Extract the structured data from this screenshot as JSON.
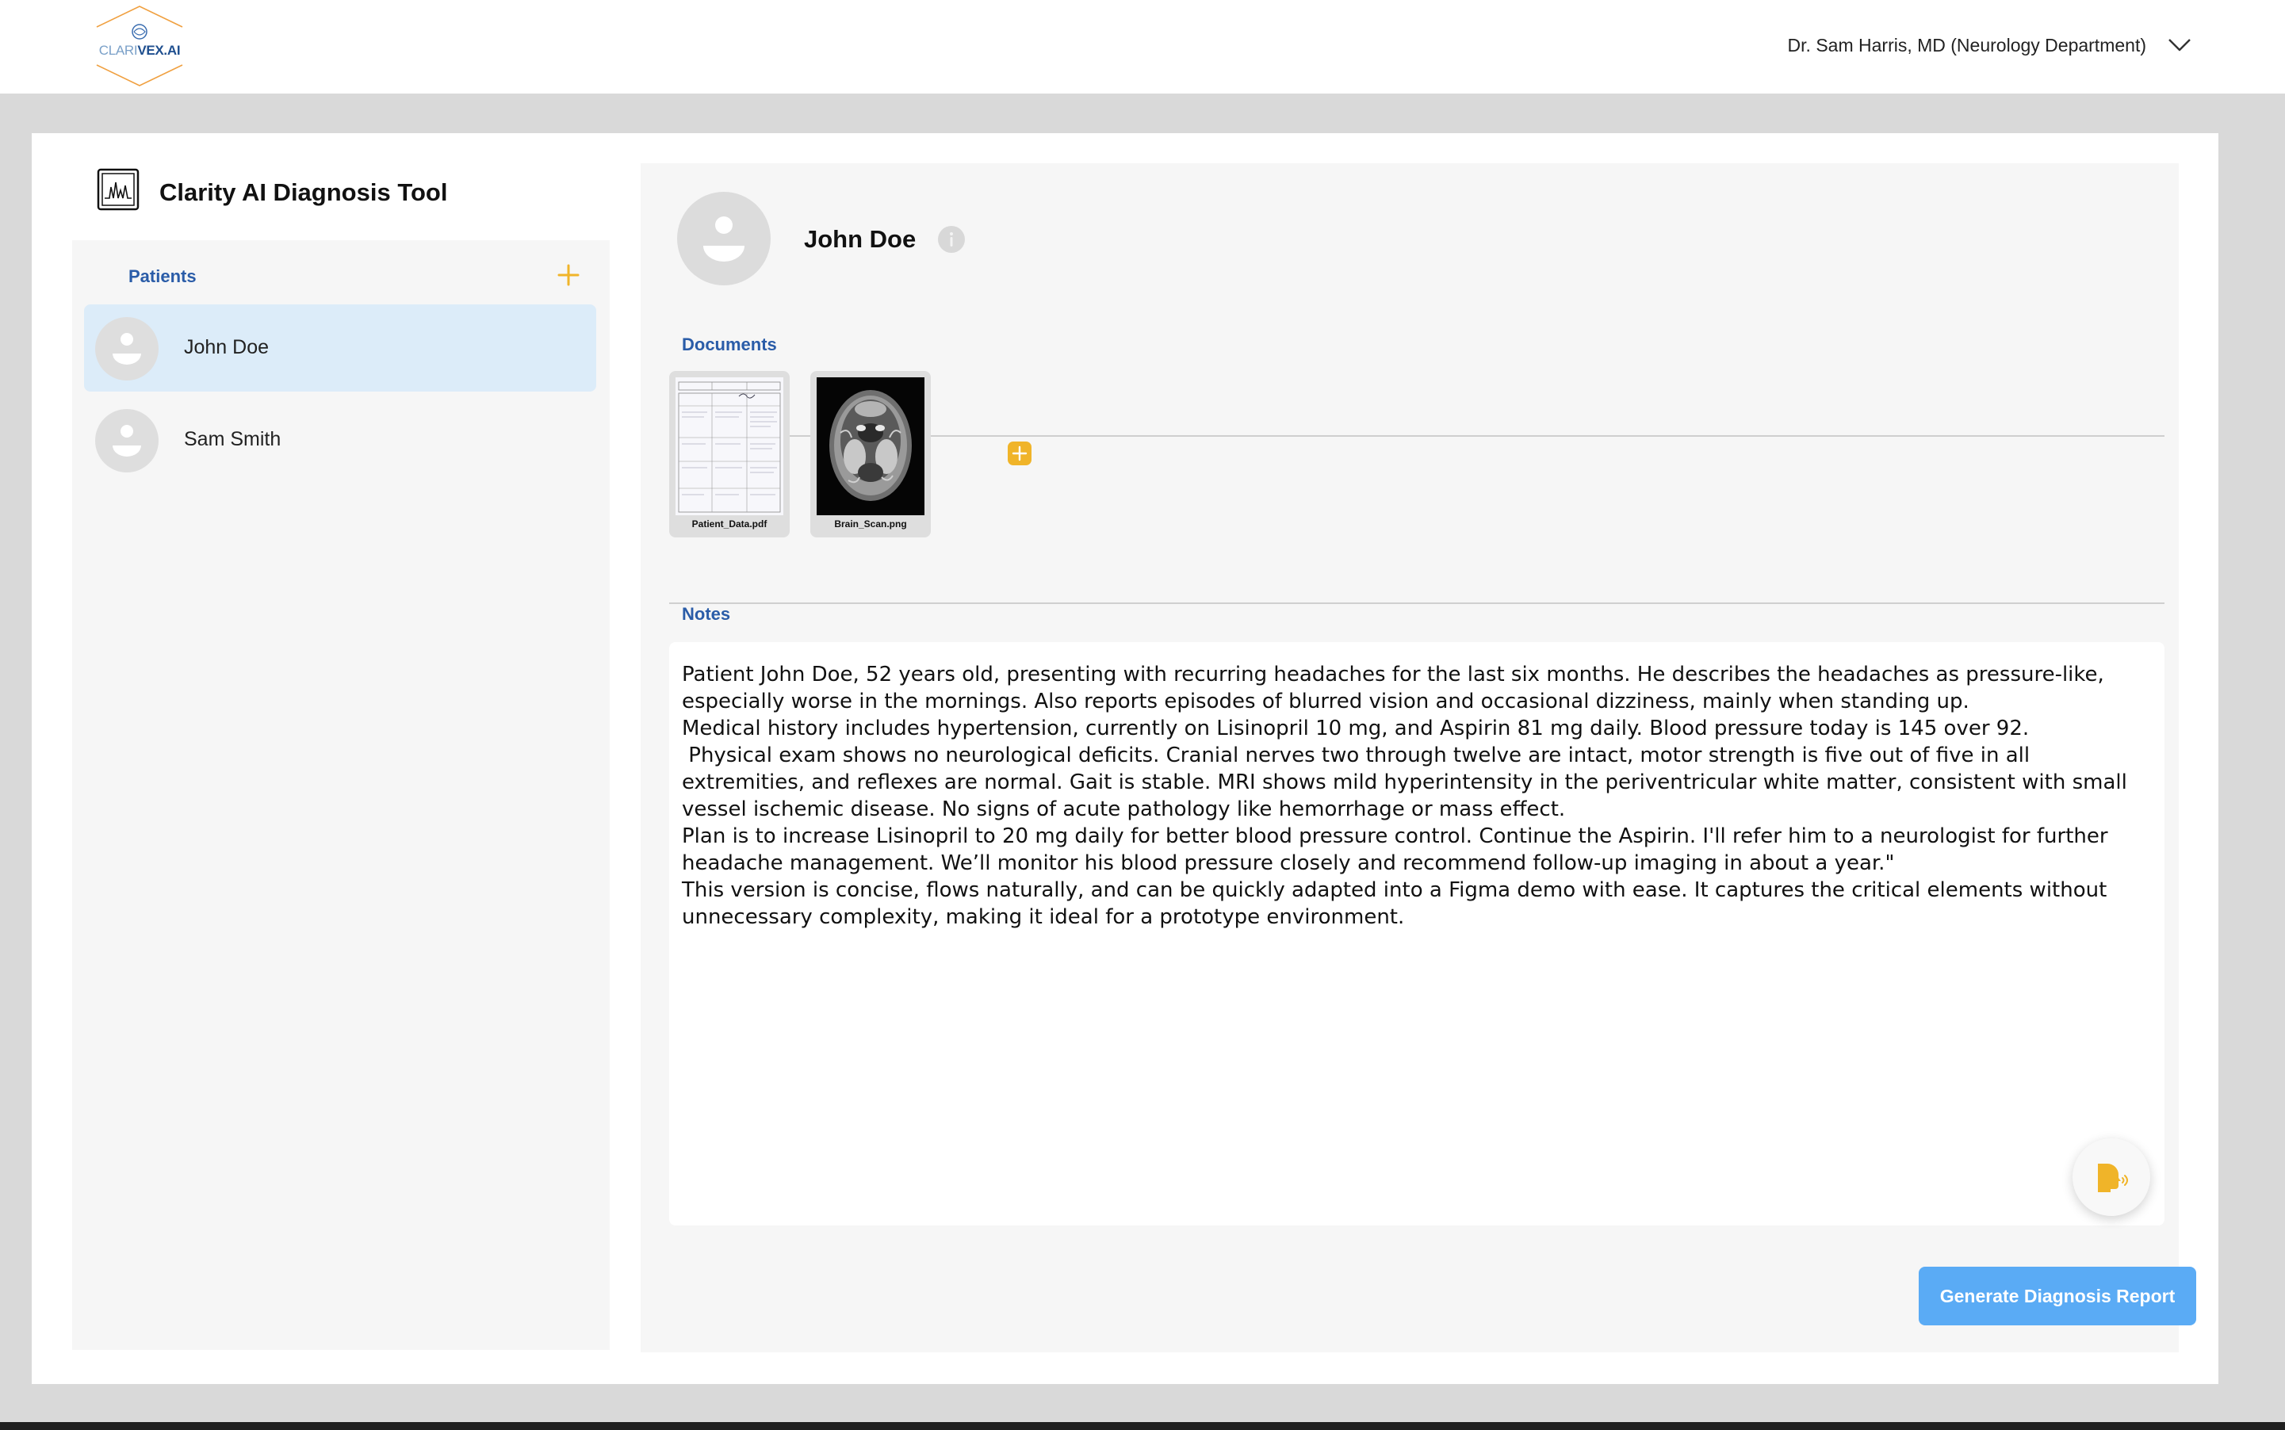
{
  "header": {
    "logo_text_light": "CLARI",
    "logo_text_bold": "VEX.AI",
    "doctor_label": "Dr. Sam Harris, MD (Neurology Department)",
    "chevron_icon": "chevron-down-icon"
  },
  "app": {
    "title": "Clarity AI Diagnosis Tool"
  },
  "sidebar": {
    "section_label": "Patients",
    "patients": [
      {
        "name": "John Doe",
        "selected": true
      },
      {
        "name": "Sam Smith",
        "selected": false
      }
    ]
  },
  "patient": {
    "name": "John Doe"
  },
  "documents": {
    "label": "Documents",
    "items": [
      {
        "file_name": "Patient_Data.pdf"
      },
      {
        "file_name": "Brain_Scan.png"
      }
    ]
  },
  "notes": {
    "label": "Notes",
    "text": "Patient John Doe, 52 years old, presenting with recurring headaches for the last six months. He describes the headaches as pressure-like, especially worse in the mornings. Also reports episodes of blurred vision and occasional dizziness, mainly when standing up.\nMedical history includes hypertension, currently on Lisinopril 10 mg, and Aspirin 81 mg daily. Blood pressure today is 145 over 92.\n Physical exam shows no neurological deficits. Cranial nerves two through twelve are intact, motor strength is five out of five in all extremities, and reflexes are normal. Gait is stable. MRI shows mild hyperintensity in the periventricular white matter, consistent with small vessel ischemic disease. No signs of acute pathology like hemorrhage or mass effect.\nPlan is to increase Lisinopril to 20 mg daily for better blood pressure control. Continue the Aspirin. I'll refer him to a neurologist for further headache management. We’ll monitor his blood pressure closely and recommend follow-up imaging in about a year.\"\nThis version is concise, flows naturally, and can be quickly adapted into a Figma demo with ease. It captures the critical elements without unnecessary complexity, making it ideal for a prototype environment."
  },
  "actions": {
    "generate_label": "Generate Diagnosis Report"
  },
  "colors": {
    "accent_blue": "#2a5ca8",
    "accent_orange": "#f0b429",
    "button_blue": "#5aabf5",
    "selected_row": "#dcecf9"
  }
}
